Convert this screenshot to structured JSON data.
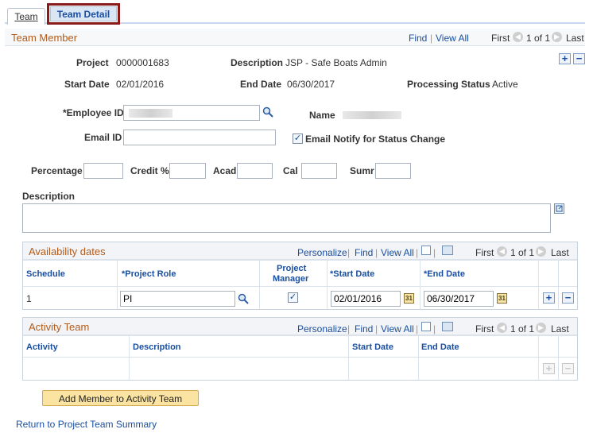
{
  "tabs": {
    "team": "Team",
    "team_detail": "Team Detail"
  },
  "team_member": {
    "title": "Team Member",
    "find": "Find",
    "view_all": "View All",
    "first": "First",
    "pager": "1 of 1",
    "last": "Last",
    "project_label": "Project",
    "project_value": "0000001683",
    "description_label": "Description",
    "description_value": "JSP - Safe Boats Admin",
    "start_date_label": "Start Date",
    "start_date_value": "02/01/2016",
    "end_date_label": "End Date",
    "end_date_value": "06/30/2017",
    "processing_status_label": "Processing Status",
    "processing_status_value": "Active",
    "employee_id_label": "*Employee ID",
    "employee_id_value": "",
    "name_label": "Name",
    "email_id_label": "Email ID",
    "email_id_value": "",
    "email_notify_label": "Email Notify for Status Change",
    "percentage_label": "Percentage",
    "credit_label": "Credit %",
    "acad_label": "Acad",
    "cal_label": "Cal",
    "sumr_label": "Sumr",
    "desc_area_label": "Description"
  },
  "availability": {
    "title": "Availability dates",
    "personalize": "Personalize",
    "find": "Find",
    "view_all": "View All",
    "first": "First",
    "pager": "1 of 1",
    "last": "Last",
    "headers": {
      "schedule": "Schedule",
      "project_role": "*Project Role",
      "project_manager_1": "Project",
      "project_manager_2": "Manager",
      "start_date": "*Start Date",
      "end_date": "*End Date"
    },
    "row": {
      "schedule": "1",
      "project_role": "PI",
      "project_manager_checked": true,
      "start_date": "02/01/2016",
      "end_date": "06/30/2017"
    }
  },
  "activity_team": {
    "title": "Activity Team",
    "personalize": "Personalize",
    "find": "Find",
    "view_all": "View All",
    "first": "First",
    "pager": "1 of 1",
    "last": "Last",
    "headers": {
      "activity": "Activity",
      "description": "Description",
      "start_date": "Start Date",
      "end_date": "End Date"
    }
  },
  "add_member_button": "Add Member to Activity Team",
  "return_link": "Return to Project Team Summary",
  "icons": {
    "nav_prev": "circle-left-arrow-icon",
    "nav_next": "circle-right-arrow-icon",
    "lookup": "magnifier-icon",
    "calendar": "calendar-icon",
    "expand": "expand-icon"
  },
  "colors": {
    "section_title": "#b35b1a",
    "link": "#1a4fa0",
    "button": "#fbe3a2"
  }
}
